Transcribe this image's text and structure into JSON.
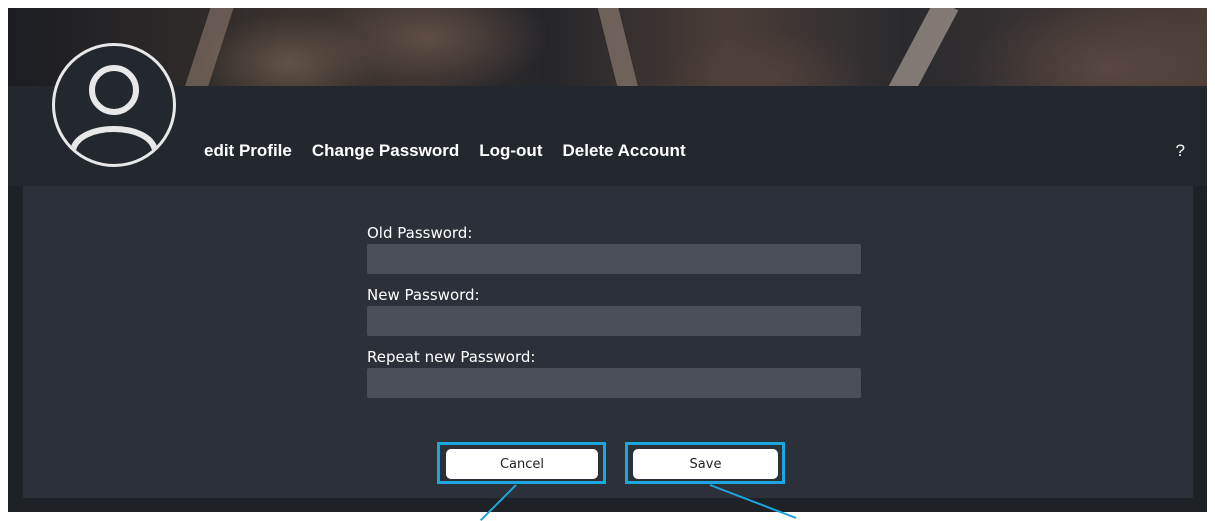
{
  "nav": {
    "items": [
      "edit Profile",
      "Change Password",
      "Log-out",
      "Delete Account"
    ],
    "help": "?"
  },
  "form": {
    "old_password_label": "Old Password:",
    "new_password_label": "New Password:",
    "repeat_password_label": "Repeat new Password:",
    "old_password_value": "",
    "new_password_value": "",
    "repeat_password_value": ""
  },
  "buttons": {
    "cancel": "Cancel",
    "save": "Save"
  },
  "colors": {
    "highlight": "#1ba6e0",
    "panel": "#2c3038",
    "input": "#4a4f59"
  },
  "icons": [
    "user-avatar-icon"
  ]
}
